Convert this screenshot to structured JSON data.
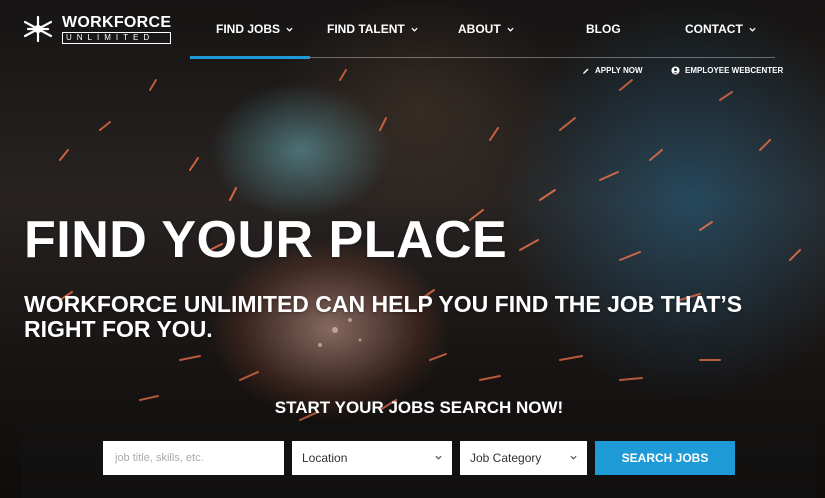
{
  "brand": {
    "name_top": "WORKFORCE",
    "name_bottom": "UNLIMITED",
    "registered": "®"
  },
  "nav": {
    "items": [
      {
        "label": "FIND JOBS",
        "has_dropdown": true,
        "active": true
      },
      {
        "label": "FIND TALENT",
        "has_dropdown": true,
        "active": false
      },
      {
        "label": "ABOUT",
        "has_dropdown": true,
        "active": false
      },
      {
        "label": "BLOG",
        "has_dropdown": false,
        "active": false
      },
      {
        "label": "CONTACT",
        "has_dropdown": true,
        "active": false
      }
    ]
  },
  "utility_links": {
    "apply": {
      "label": "APPLY NOW",
      "icon": "pencil-icon"
    },
    "employee": {
      "label": "EMPLOYEE WEBCENTER",
      "icon": "user-circle-icon"
    }
  },
  "hero": {
    "headline": "FIND YOUR PLACE",
    "subheadline": "WORKFORCE UNLIMITED CAN HELP YOU FIND THE JOB THAT’S RIGHT FOR YOU."
  },
  "search": {
    "title": "START YOUR JOBS SEARCH NOW!",
    "keyword_placeholder": "job title, skills, etc.",
    "location_value": "Location",
    "category_value": "Job Category",
    "button_label": "SEARCH JOBS"
  },
  "colors": {
    "accent": "#1e9ad6",
    "text": "#ffffff"
  }
}
